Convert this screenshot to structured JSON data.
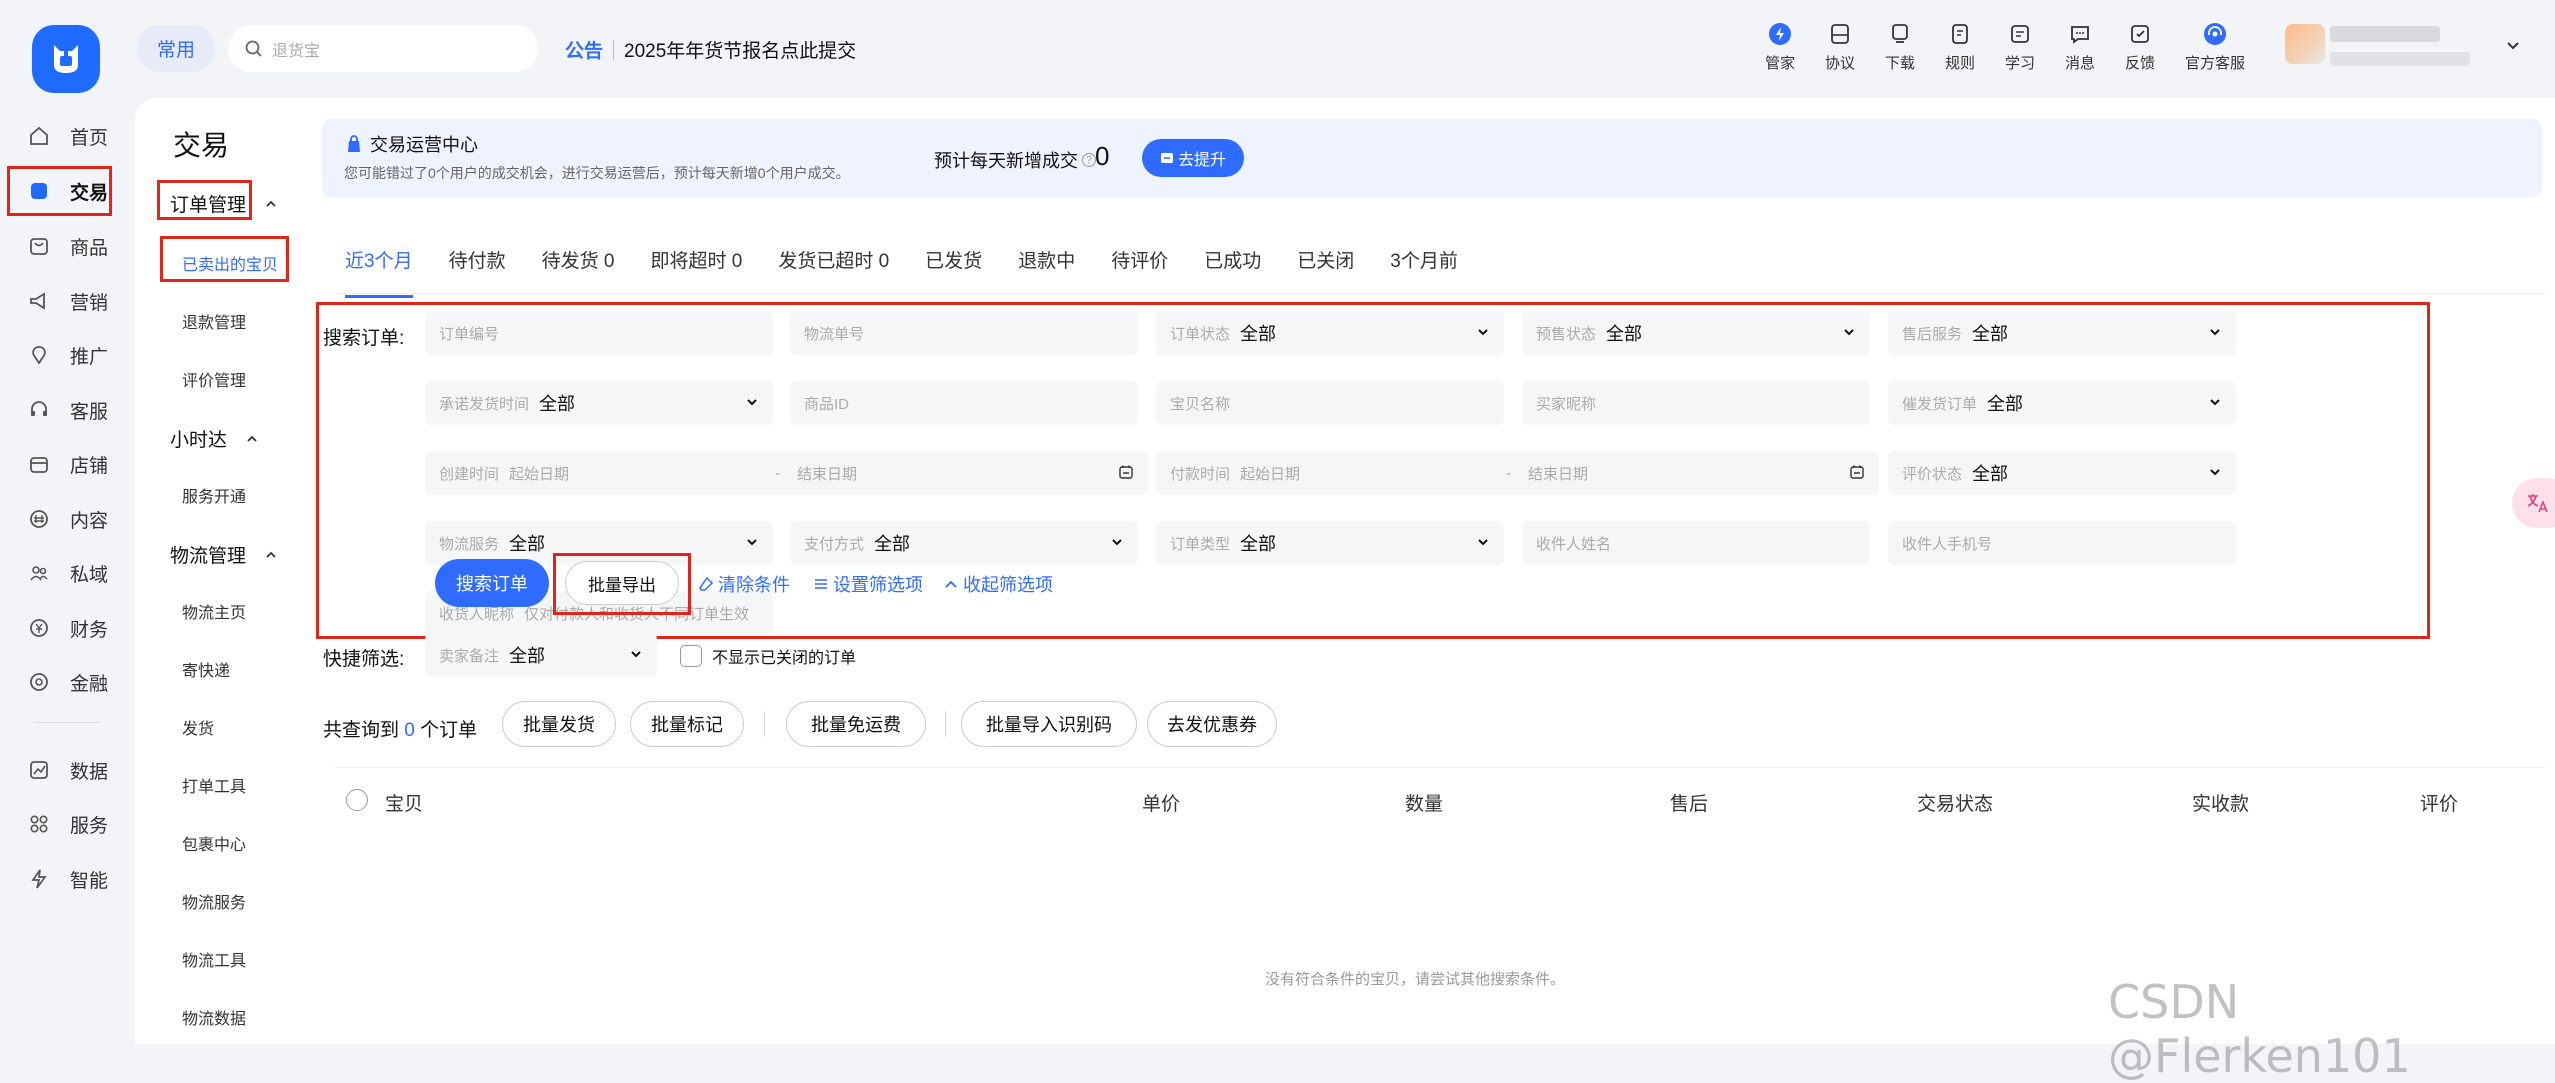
{
  "rail": {
    "items": [
      {
        "label": "首页",
        "icon": "home-icon"
      },
      {
        "label": "交易",
        "icon": "trade-icon"
      },
      {
        "label": "商品",
        "icon": "goods-icon"
      },
      {
        "label": "营销",
        "icon": "marketing-icon"
      },
      {
        "label": "推广",
        "icon": "promote-icon"
      },
      {
        "label": "客服",
        "icon": "service-icon"
      },
      {
        "label": "店铺",
        "icon": "shop-icon"
      },
      {
        "label": "内容",
        "icon": "content-icon"
      },
      {
        "label": "私域",
        "icon": "private-icon"
      },
      {
        "label": "财务",
        "icon": "finance-icon"
      },
      {
        "label": "金融",
        "icon": "fintech-icon"
      },
      {
        "label": "数据",
        "icon": "data-icon"
      },
      {
        "label": "服务",
        "icon": "services-icon"
      },
      {
        "label": "智能",
        "icon": "smart-icon"
      }
    ]
  },
  "topbar": {
    "common_label": "常用",
    "search_placeholder": "退货宝",
    "notice_tag": "公告",
    "notice_text": "2025年年货节报名点此提交",
    "tools": [
      {
        "label": "管家",
        "icon": "butler-icon"
      },
      {
        "label": "协议",
        "icon": "agreement-icon"
      },
      {
        "label": "下载",
        "icon": "download-icon"
      },
      {
        "label": "规则",
        "icon": "rules-icon"
      },
      {
        "label": "学习",
        "icon": "learn-icon"
      },
      {
        "label": "消息",
        "icon": "message-icon"
      },
      {
        "label": "反馈",
        "icon": "feedback-icon"
      },
      {
        "label": "官方客服",
        "icon": "official-service-icon"
      }
    ]
  },
  "subnav": {
    "title": "交易",
    "group1": "订单管理",
    "g1_items": [
      "已卖出的宝贝",
      "退款管理",
      "评价管理"
    ],
    "group2": "小时达",
    "g2_items": [
      "服务开通"
    ],
    "group3": "物流管理",
    "g3_items": [
      "物流主页",
      "寄快递",
      "发货",
      "打单工具",
      "包裹中心",
      "物流服务",
      "物流工具",
      "物流数据"
    ]
  },
  "banner": {
    "title": "交易运营中心",
    "desc": "您可能错过了0个用户的成交机会，进行交易运营后，预计每天新增0个用户成交。",
    "estimate_label": "预计每天新增成交",
    "estimate_value": "0",
    "button": "去提升"
  },
  "tabs": [
    "近3个月",
    "待付款",
    "待发货 0",
    "即将超时 0",
    "发货已超时 0",
    "已发货",
    "退款中",
    "待评价",
    "已成功",
    "已关闭",
    "3个月前"
  ],
  "form": {
    "label": "搜索订单:",
    "order_no": "订单编号",
    "logistics_no": "物流单号",
    "order_status": "订单状态",
    "presale_status": "预售状态",
    "after_sale": "售后服务",
    "promise_ship_time": "承诺发货时间",
    "goods_id": "商品ID",
    "item_name": "宝贝名称",
    "buyer_nick": "买家昵称",
    "urge_ship": "催发货订单",
    "create_time": "创建时间",
    "start_date": "起始日期",
    "end_date": "结束日期",
    "pay_time": "付款时间",
    "review_status": "评价状态",
    "logistics_service": "物流服务",
    "pay_method": "支付方式",
    "order_type": "订单类型",
    "receiver_name": "收件人姓名",
    "receiver_phone": "收件人手机号",
    "receiver_nick": "收货人昵称",
    "receiver_nick_hint": "仅对付款人和收货人不同订单生效",
    "all": "全部",
    "dash": "-"
  },
  "actions": {
    "search": "搜索订单",
    "export": "批量导出",
    "clear": "清除条件",
    "settings": "设置筛选项",
    "collapse": "收起筛选项"
  },
  "quick": {
    "label": "快捷筛选:",
    "remark": "卖家备注",
    "remark_value": "全部",
    "hide_closed": "不显示已关闭的订单"
  },
  "count": {
    "prefix": "共查询到",
    "number": "0",
    "suffix": "个订单",
    "buttons": [
      "批量发货",
      "批量标记",
      "批量免运费",
      "批量导入识别码",
      "去发优惠券"
    ]
  },
  "table": {
    "headers": [
      "宝贝",
      "单价",
      "数量",
      "售后",
      "交易状态",
      "实收款",
      "评价"
    ],
    "empty": "没有符合条件的宝贝，请尝试其他搜索条件。"
  },
  "watermark": "CSDN @Flerken101",
  "colors": {
    "accent": "#2f6bff",
    "highlight_box": "#e0251b"
  }
}
